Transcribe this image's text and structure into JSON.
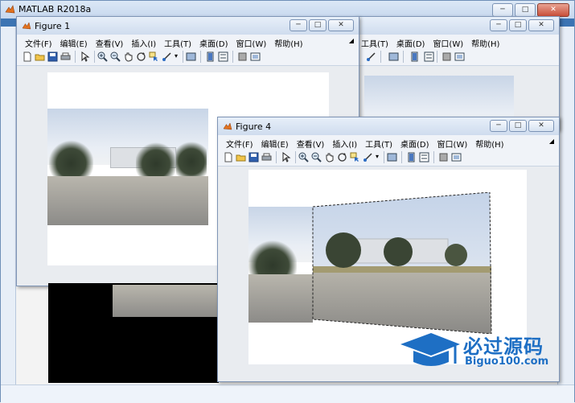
{
  "main": {
    "title": "MATLAB R2018a",
    "controls": {
      "min": "─",
      "max": "□",
      "close": "✕"
    }
  },
  "figures": [
    {
      "title": "Figure 1",
      "menus": [
        "文件(F)",
        "编辑(E)",
        "查看(V)",
        "插入(I)",
        "工具(T)",
        "桌面(D)",
        "窗口(W)",
        "帮助(H)"
      ]
    },
    {
      "title": "Figure 4",
      "menus": [
        "文件(F)",
        "编辑(E)",
        "查看(V)",
        "插入(I)",
        "工具(T)",
        "桌面(D)",
        "窗口(W)",
        "帮助(H)"
      ]
    }
  ],
  "background_figure": {
    "menus": [
      "工具(T)",
      "桌面(D)",
      "窗口(W)",
      "帮助(H)"
    ]
  },
  "watermark": {
    "title": "必过源码",
    "subtitle": "Biguo100.com"
  },
  "icons": {
    "toolbar": [
      "new-figure-icon",
      "open-file-icon",
      "save-icon",
      "print-icon",
      "pointer-icon",
      "zoom-in-icon",
      "zoom-out-icon",
      "pan-icon",
      "rotate-icon",
      "data-cursor-icon",
      "brush-icon",
      "link-icon",
      "colorbar-icon",
      "legend-icon",
      "hide-tools-icon",
      "show-tools-icon"
    ]
  }
}
